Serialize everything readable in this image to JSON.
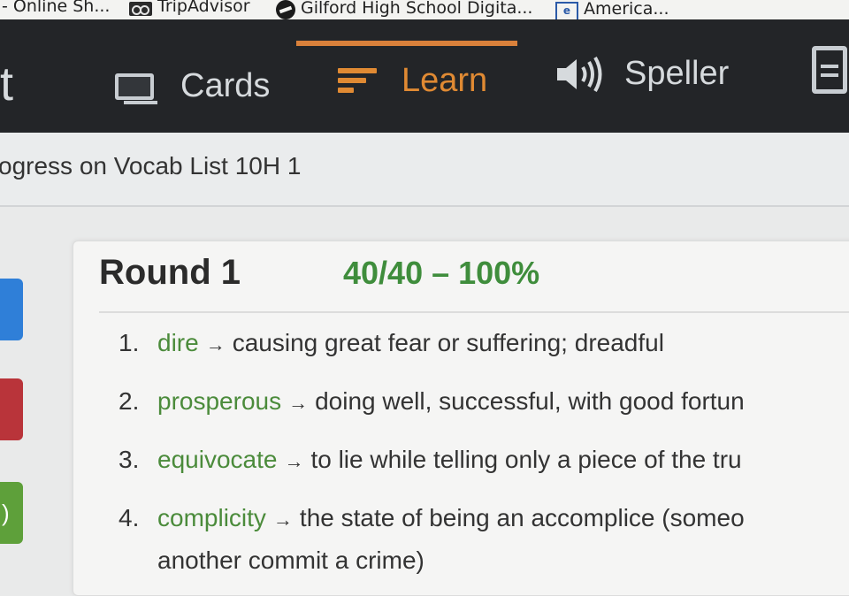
{
  "bookmarks": [
    {
      "label": "- Online Sh...",
      "icon": "none"
    },
    {
      "label": "TripAdvisor",
      "icon": "tripadvisor-icon"
    },
    {
      "label": "Gilford High School Digita...",
      "icon": "gilford-icon"
    },
    {
      "label": "America...",
      "icon": "e-icon"
    }
  ],
  "nav": {
    "brand_fragment": "t",
    "items": [
      {
        "label": "Cards",
        "icon": "cards-icon"
      },
      {
        "label": "Learn",
        "icon": "learn-icon",
        "active": true
      },
      {
        "label": "Speller",
        "icon": "speaker-icon"
      },
      {
        "label": "",
        "icon": "document-icon"
      }
    ],
    "accent_color": "#d9813b"
  },
  "progress_title": "ogress on Vocab List 10H 1",
  "side_tabs": [
    {
      "color": "#2f7fd8",
      "label": ""
    },
    {
      "color": "#b9343a",
      "label": ""
    },
    {
      "color": "#5ea03a",
      "label": ")"
    }
  ],
  "round": {
    "title": "Round 1",
    "score": "40/40 – 100%",
    "score_color": "#3f8d3c"
  },
  "terms": [
    {
      "num": "1.",
      "word": "dire",
      "arrow": "→",
      "definition": "causing great fear or suffering; dreadful"
    },
    {
      "num": "2.",
      "word": "prosperous",
      "arrow": "→",
      "definition": "doing well, successful, with good fortun"
    },
    {
      "num": "3.",
      "word": "equivocate",
      "arrow": "→",
      "definition": "to lie while telling only a piece of the tru"
    },
    {
      "num": "4.",
      "word": "complicity",
      "arrow": "→",
      "definition": "the state of being an accomplice (someo"
    }
  ],
  "term4_continuation": "another commit a crime)"
}
